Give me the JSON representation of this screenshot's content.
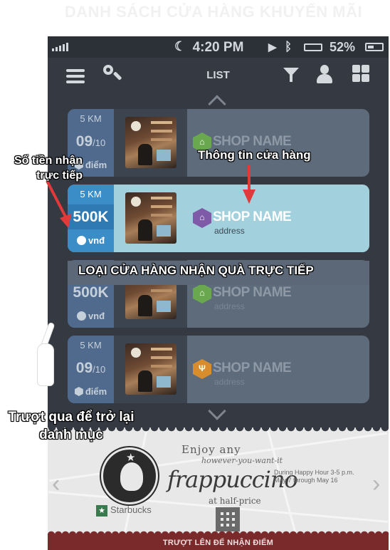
{
  "page_title": "DANH SÁCH CỬA HÀNG KHUYẾN MÃI",
  "status_bar": {
    "time": "4:20 PM",
    "battery_percent": "52%"
  },
  "nav": {
    "title": "LIST"
  },
  "stores": [
    {
      "distance": "5 KM",
      "value": "09",
      "value_suffix": "/10",
      "unit": "điểm",
      "name": "SHOP NAME",
      "address": "",
      "category_icon": "store-icon",
      "category_color": "#6aa84f",
      "state": "dim"
    },
    {
      "distance": "5 KM",
      "value": "500K",
      "value_suffix": "",
      "unit": "vnđ",
      "name": "SHOP NAME",
      "address": "address",
      "category_icon": "hanger-icon",
      "category_color": "#7e5aa8",
      "state": "active"
    },
    {
      "distance": "",
      "value": "500K",
      "value_suffix": "",
      "unit": "vnđ",
      "name": "SHOP NAME",
      "address": "address",
      "category_icon": "store-icon",
      "category_color": "#6aa84f",
      "state": "dim"
    },
    {
      "distance": "5 KM",
      "value": "09",
      "value_suffix": "/10",
      "unit": "điểm",
      "name": "SHOP NAME",
      "address": "address",
      "category_icon": "restaurant-icon",
      "category_color": "#d98c2b",
      "state": "dim"
    }
  ],
  "banner": {
    "enjoy": "Enjoy any",
    "however": "however-you-want-it",
    "product": "frappuccino",
    "half_price": "at half-price",
    "during": "During Happy Hour 3-5 p.m. May 7 through May 16",
    "brand": "Starbucks"
  },
  "swipe_up": "TRƯỢT LÊN ĐỂ NHẬN ĐIỂM",
  "annotations": {
    "money": "Số tiền nhận trực tiếp",
    "shop_info": "Thông tin cửa hàng",
    "store_type": "LOẠI CỬA HÀNG NHẬN QUÀ TRỰC TIẾP",
    "swipe_back": "Trượt qua để trở lại danh mục"
  },
  "colors": {
    "background": "#353941",
    "active_card": "#a2d0dd",
    "active_left": "#3b8dc8",
    "arrow": "#e23a3a",
    "swipe_bar": "#7a2a2a"
  }
}
